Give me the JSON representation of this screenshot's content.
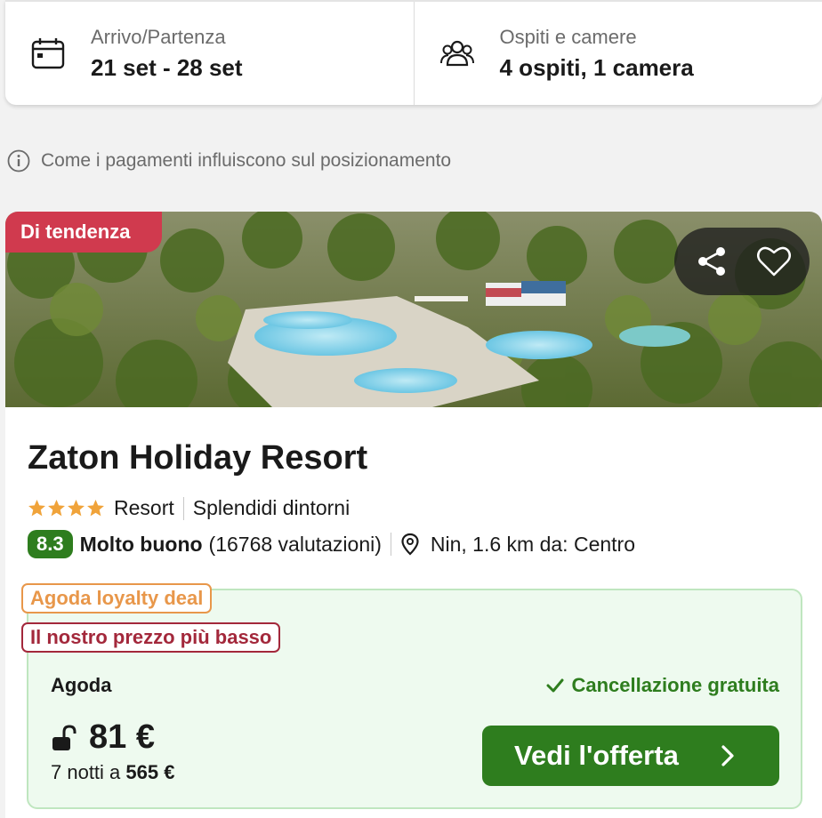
{
  "search": {
    "dates_label": "Arrivo/Partenza",
    "dates_value": "21 set - 28 set",
    "guests_label": "Ospiti e camere",
    "guests_value": "4 ospiti, 1 camera"
  },
  "info_text": "Come i pagamenti influiscono sul posizionamento",
  "hotel": {
    "badge": "Di tendenza",
    "name": "Zaton Holiday Resort",
    "stars": 4,
    "type": "Resort",
    "highlight": "Splendidi dintorni",
    "score": "8.3",
    "rating_text": "Molto buono",
    "reviews": "(16768 valutazioni)",
    "location": "Nin, 1.6 km da: Centro"
  },
  "offer": {
    "tag_loyalty": "Agoda loyalty deal",
    "tag_lowest": "Il nostro prezzo più basso",
    "provider": "Agoda",
    "cancellation": "Cancellazione gratuita",
    "price": "81 €",
    "total_prefix": "7 notti a",
    "total_value": "565 €",
    "cta": "Vedi l'offerta"
  },
  "colors": {
    "accent_green": "#2e7d1e",
    "badge_red": "#d03a4e",
    "loyalty_orange": "#e8974a",
    "lowest_red": "#a3283b"
  },
  "icons": [
    "calendar-icon",
    "guests-icon",
    "info-icon",
    "share-icon",
    "heart-icon",
    "star-icon",
    "location-pin-icon",
    "check-icon",
    "unlock-icon",
    "chevron-right-icon"
  ]
}
